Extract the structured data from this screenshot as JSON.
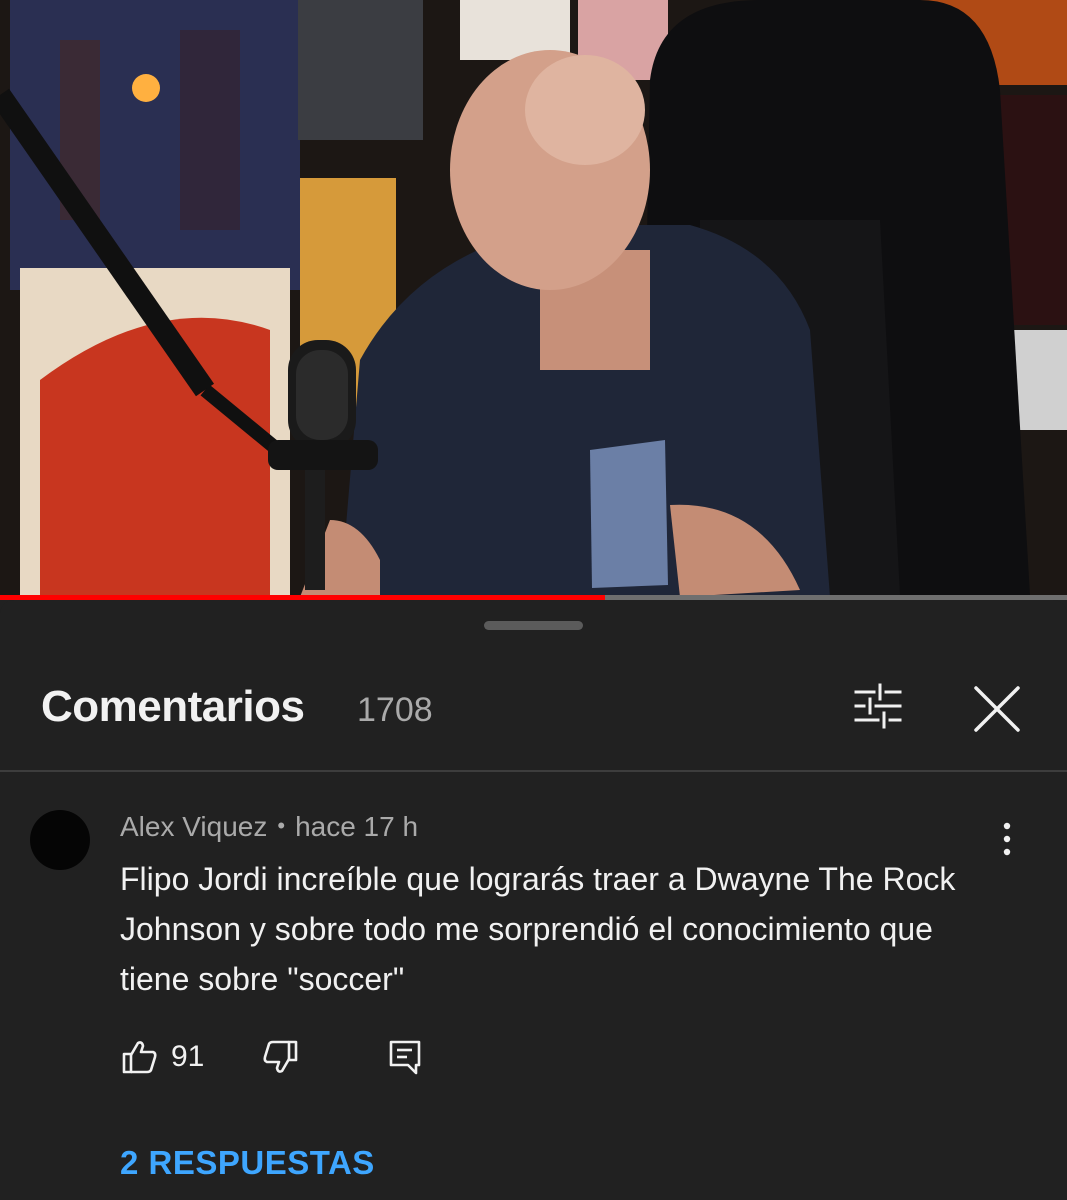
{
  "video": {
    "progress": 0.567,
    "colors": {
      "played": "#ff0000",
      "unplayed": "#6f6f6f"
    }
  },
  "comments_panel": {
    "title": "Comentarios",
    "count": "1708",
    "icons": {
      "filter": "sliders-icon",
      "close": "close-icon"
    }
  },
  "comment": {
    "author": "Alex Viquez",
    "separator": "•",
    "time": "hace 17 h",
    "text": "Flipo Jordi increíble que lograrás traer a Dwayne The Rock Johnson y sobre todo me sorprendió el conocimiento que tiene sobre \"soccer\"",
    "likes": "91",
    "icons": {
      "like": "thumbs-up-icon",
      "dislike": "thumbs-down-icon",
      "reply": "reply-icon",
      "more": "more-vertical-icon"
    },
    "replies_label": "2 RESPUESTAS",
    "replies_color": "#3ea6ff"
  }
}
